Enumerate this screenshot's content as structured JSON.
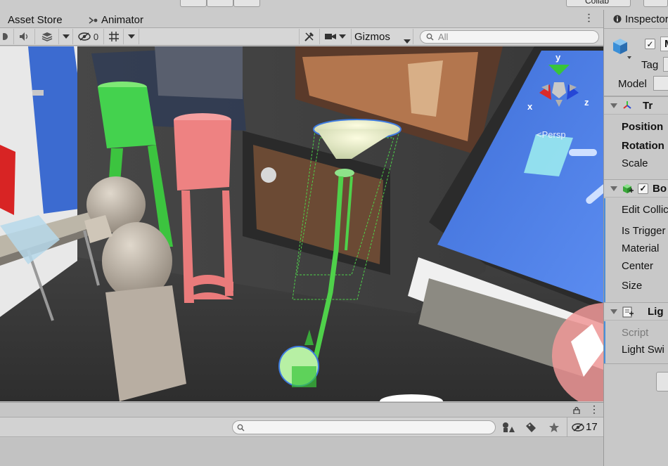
{
  "tabs": {
    "asset_store": "Asset Store",
    "animator": "Animator"
  },
  "top_strip": {
    "collab_label": "Collab"
  },
  "scene_toolbar": {
    "hidden_layers_count": "0",
    "gizmos_label": "Gizmos",
    "search_placeholder": "All"
  },
  "viewport": {
    "projection_label": "<Persp",
    "axes": {
      "x": "x",
      "y": "y",
      "z": "z"
    }
  },
  "console": {
    "hidden_count": "17"
  },
  "inspector": {
    "tab_label": "Inspector",
    "name_prefix": "M",
    "tag_label": "Tag",
    "model_label": "Model",
    "transform": {
      "header": "Tr",
      "position": "Position",
      "rotation": "Rotation",
      "scale": "Scale"
    },
    "box_collider": {
      "header": "Bo",
      "edit_collider": "Edit Collic",
      "is_trigger": "Is Trigger",
      "material": "Material",
      "center": "Center",
      "size": "Size"
    },
    "script_component": {
      "header": "Lig",
      "script_label": "Script",
      "field_label": "Light Swi"
    }
  },
  "colors": {
    "selection_green": "#4fd14a",
    "accent_blue": "#4a8edb",
    "axis_x": "#d92b2b",
    "axis_y": "#38c43a",
    "axis_z": "#2547d6"
  }
}
